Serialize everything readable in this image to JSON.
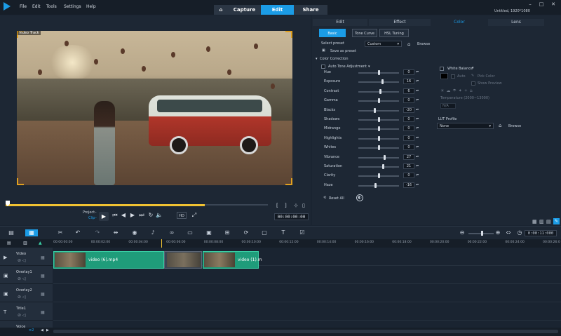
{
  "app": {
    "window_title": "Untitled, 1920*1080",
    "menus": [
      "File",
      "Edit",
      "Tools",
      "Settings",
      "Help"
    ],
    "main_tabs": [
      "Capture",
      "Edit",
      "Share"
    ]
  },
  "player": {
    "track_label": "Video Track",
    "project_label": "Project–",
    "clip_label": "Clip–",
    "timecode": "00:00:00:00",
    "scrub_progress": 0.76
  },
  "panel": {
    "tabs": [
      "Edit",
      "Effect",
      "Color",
      "Lens"
    ],
    "color_tabs": [
      "Basic",
      "Tone Curve",
      "HSL Tuning"
    ],
    "select_preset_label": "Select preset",
    "preset_value": "Custom",
    "browse_label": "Browse",
    "save_as_preset": "Save as preset",
    "color_correction": "Color Correction",
    "auto_tone": "Auto Tone Adjustment",
    "reset_all": "Reset All",
    "white_balance": "White Balance",
    "auto": "Auto",
    "pick_color": "Pick Color",
    "show_preview": "Show Preview",
    "temperature": "Temperature (2000~13000)",
    "temperature_value": "N/A",
    "lut_profile": "LUT Profile",
    "lut_value": "None",
    "lut_browse": "Browse",
    "sliders": [
      {
        "label": "Hue",
        "value": "0"
      },
      {
        "label": "Exposure",
        "value": "16"
      },
      {
        "label": "Contrast",
        "value": "6"
      },
      {
        "label": "Gamma",
        "value": "0"
      },
      {
        "label": "Blacks",
        "value": "-20"
      },
      {
        "label": "Shadows",
        "value": "0"
      },
      {
        "label": "Midrange",
        "value": "0"
      },
      {
        "label": "Highlights",
        "value": "0"
      },
      {
        "label": "Whites",
        "value": "0"
      },
      {
        "label": "Vibrance",
        "value": "27"
      },
      {
        "label": "Saturation",
        "value": "21"
      },
      {
        "label": "Clarity",
        "value": "0"
      },
      {
        "label": "Haze",
        "value": "-16"
      }
    ]
  },
  "timeline": {
    "zoom_timecode": "0:00:11:000",
    "ruler": [
      "00:00:00:00",
      "00:00:02:00",
      "00:00:04:00",
      "00:00:06:00",
      "00:00:08:00",
      "00:00:10:00",
      "00:00:12:00",
      "00:00:14:00",
      "00:00:16:00",
      "00:00:18:00",
      "00:00:20:00",
      "00:00:22:00",
      "00:00:24:00",
      "00:00:26:0"
    ],
    "tracks": [
      "Video",
      "Overlay1",
      "Overlay2",
      "Title1",
      "Voice"
    ],
    "clips": [
      "video (6).mp4",
      "video (1).m"
    ]
  }
}
